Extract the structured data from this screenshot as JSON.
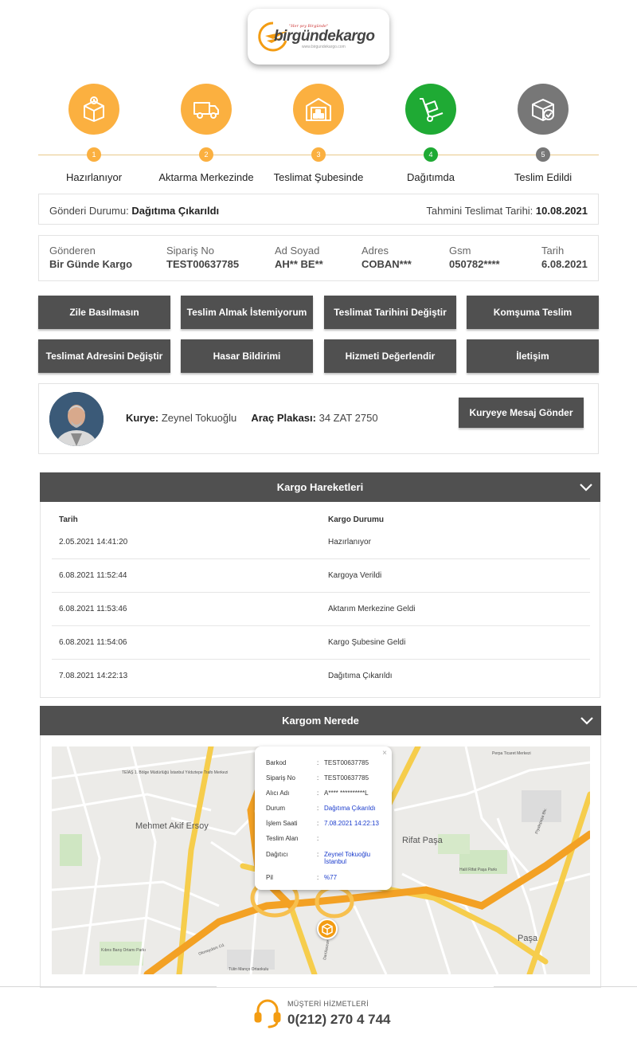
{
  "logo": {
    "tagline": "\"Her şey Birgünde\"",
    "name": "birgündekargo",
    "url": "www.birgundekargo.com"
  },
  "steps": [
    {
      "num": "1",
      "label": "Hazırlanıyor",
      "state": "done",
      "icon": "box-icon"
    },
    {
      "num": "2",
      "label": "Aktarma Merkezinde",
      "state": "done",
      "icon": "truck-icon"
    },
    {
      "num": "3",
      "label": "Teslimat Şubesinde",
      "state": "done",
      "icon": "warehouse-icon"
    },
    {
      "num": "4",
      "label": "Dağıtımda",
      "state": "active",
      "icon": "hand-truck-icon"
    },
    {
      "num": "5",
      "label": "Teslim Edildi",
      "state": "pending",
      "icon": "delivered-box-icon"
    }
  ],
  "status": {
    "label": "Gönderi Durumu:",
    "value": "Dağıtıma Çıkarıldı",
    "eta_label": "Tahmini Teslimat Tarihi:",
    "eta_value": "10.08.2021"
  },
  "info": [
    {
      "label": "Gönderen",
      "value": "Bir Günde Kargo"
    },
    {
      "label": "Sipariş No",
      "value": "TEST00637785"
    },
    {
      "label": "Ad Soyad",
      "value": "AH** BE**"
    },
    {
      "label": "Adres",
      "value": "COBAN***"
    },
    {
      "label": "Gsm",
      "value": "050782****"
    },
    {
      "label": "Tarih",
      "value": "6.08.2021"
    }
  ],
  "actions": [
    "Zile Basılmasın",
    "Teslim Almak İstemiyorum",
    "Teslimat Tarihini Değiştir",
    "Komşuma Teslim",
    "Teslimat Adresini Değiştir",
    "Hasar Bildirimi",
    "Hizmeti Değerlendir",
    "İletişim"
  ],
  "courier": {
    "label": "Kurye:",
    "name": "Zeynel Tokuoğlu",
    "plate_label": "Araç Plakası:",
    "plate": "34 ZAT 2750",
    "button": "Kuryeye Mesaj Gönder"
  },
  "moves": {
    "title": "Kargo Hareketleri",
    "col_date": "Tarih",
    "col_status": "Kargo Durumu",
    "rows": [
      {
        "date": "2.05.2021 14:41:20",
        "status": "Hazırlanıyor"
      },
      {
        "date": "6.08.2021 11:52:44",
        "status": "Kargoya Verildi"
      },
      {
        "date": "6.08.2021 11:53:46",
        "status": "Aktarım Merkezine Geldi"
      },
      {
        "date": "6.08.2021 11:54:06",
        "status": "Kargo Şubesine Geldi"
      },
      {
        "date": "7.08.2021 14:22:13",
        "status": "Dağıtıma Çıkarıldı"
      }
    ]
  },
  "where": {
    "title": "Kargom Nerede",
    "popup": {
      "close": "×",
      "rows": [
        {
          "k": "Barkod",
          "v": "TEST00637785",
          "blue": false
        },
        {
          "k": "Sipariş No",
          "v": "TEST00637785",
          "blue": false
        },
        {
          "k": "Alıcı Adı",
          "v": "A**** **********L",
          "blue": false
        },
        {
          "k": "Durum",
          "v": "Dağıtıma Çıkarıldı",
          "blue": true
        },
        {
          "k": "İşlem Saati",
          "v": "7.08.2021 14:22:13",
          "blue": true
        },
        {
          "k": "Teslim Alan",
          "v": "",
          "blue": false
        },
        {
          "k": "Dağıtıcı",
          "v": "Zeynel Tokuoğlu İstanbul",
          "blue": true
        },
        {
          "k": "Pil",
          "v": "%77",
          "blue": true
        }
      ]
    },
    "map_labels": [
      "Mehmet Akif Ersoy",
      "Rifat Paşa",
      "Paşa",
      "TEİAŞ 1. Bölge Müdürlüğü İstanbul Yıldıztepe Trafo Merkezi",
      "Perpa Ticaret Merkezi",
      "Halil Rifat Paşa Parkı",
      "Tülin Manço Ortaokulu",
      "Kıbrıs Barış Ortamı Parkı",
      "Piyalepaşa Blv.",
      "Okmeydanı Cd.",
      "Darülaceze Cd."
    ]
  },
  "support": {
    "label": "MÜŞTERİ HİZMETLERİ",
    "phone": "0(212) 270 4 744"
  }
}
